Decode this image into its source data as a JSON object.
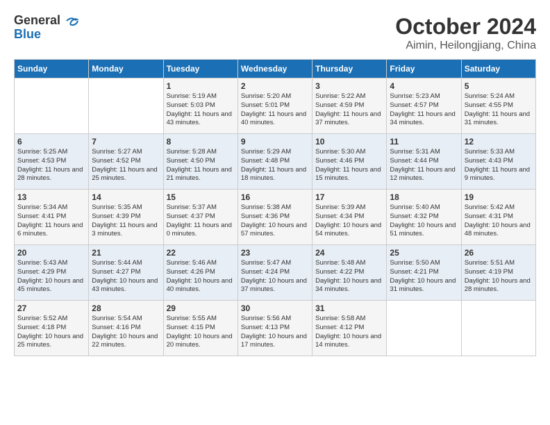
{
  "header": {
    "logo_general": "General",
    "logo_blue": "Blue",
    "month_title": "October 2024",
    "location": "Aimin, Heilongjiang, China"
  },
  "days_of_week": [
    "Sunday",
    "Monday",
    "Tuesday",
    "Wednesday",
    "Thursday",
    "Friday",
    "Saturday"
  ],
  "weeks": [
    [
      {
        "day": "",
        "sunrise": "",
        "sunset": "",
        "daylight": ""
      },
      {
        "day": "",
        "sunrise": "",
        "sunset": "",
        "daylight": ""
      },
      {
        "day": "1",
        "sunrise": "Sunrise: 5:19 AM",
        "sunset": "Sunset: 5:03 PM",
        "daylight": "Daylight: 11 hours and 43 minutes."
      },
      {
        "day": "2",
        "sunrise": "Sunrise: 5:20 AM",
        "sunset": "Sunset: 5:01 PM",
        "daylight": "Daylight: 11 hours and 40 minutes."
      },
      {
        "day": "3",
        "sunrise": "Sunrise: 5:22 AM",
        "sunset": "Sunset: 4:59 PM",
        "daylight": "Daylight: 11 hours and 37 minutes."
      },
      {
        "day": "4",
        "sunrise": "Sunrise: 5:23 AM",
        "sunset": "Sunset: 4:57 PM",
        "daylight": "Daylight: 11 hours and 34 minutes."
      },
      {
        "day": "5",
        "sunrise": "Sunrise: 5:24 AM",
        "sunset": "Sunset: 4:55 PM",
        "daylight": "Daylight: 11 hours and 31 minutes."
      }
    ],
    [
      {
        "day": "6",
        "sunrise": "Sunrise: 5:25 AM",
        "sunset": "Sunset: 4:53 PM",
        "daylight": "Daylight: 11 hours and 28 minutes."
      },
      {
        "day": "7",
        "sunrise": "Sunrise: 5:27 AM",
        "sunset": "Sunset: 4:52 PM",
        "daylight": "Daylight: 11 hours and 25 minutes."
      },
      {
        "day": "8",
        "sunrise": "Sunrise: 5:28 AM",
        "sunset": "Sunset: 4:50 PM",
        "daylight": "Daylight: 11 hours and 21 minutes."
      },
      {
        "day": "9",
        "sunrise": "Sunrise: 5:29 AM",
        "sunset": "Sunset: 4:48 PM",
        "daylight": "Daylight: 11 hours and 18 minutes."
      },
      {
        "day": "10",
        "sunrise": "Sunrise: 5:30 AM",
        "sunset": "Sunset: 4:46 PM",
        "daylight": "Daylight: 11 hours and 15 minutes."
      },
      {
        "day": "11",
        "sunrise": "Sunrise: 5:31 AM",
        "sunset": "Sunset: 4:44 PM",
        "daylight": "Daylight: 11 hours and 12 minutes."
      },
      {
        "day": "12",
        "sunrise": "Sunrise: 5:33 AM",
        "sunset": "Sunset: 4:43 PM",
        "daylight": "Daylight: 11 hours and 9 minutes."
      }
    ],
    [
      {
        "day": "13",
        "sunrise": "Sunrise: 5:34 AM",
        "sunset": "Sunset: 4:41 PM",
        "daylight": "Daylight: 11 hours and 6 minutes."
      },
      {
        "day": "14",
        "sunrise": "Sunrise: 5:35 AM",
        "sunset": "Sunset: 4:39 PM",
        "daylight": "Daylight: 11 hours and 3 minutes."
      },
      {
        "day": "15",
        "sunrise": "Sunrise: 5:37 AM",
        "sunset": "Sunset: 4:37 PM",
        "daylight": "Daylight: 11 hours and 0 minutes."
      },
      {
        "day": "16",
        "sunrise": "Sunrise: 5:38 AM",
        "sunset": "Sunset: 4:36 PM",
        "daylight": "Daylight: 10 hours and 57 minutes."
      },
      {
        "day": "17",
        "sunrise": "Sunrise: 5:39 AM",
        "sunset": "Sunset: 4:34 PM",
        "daylight": "Daylight: 10 hours and 54 minutes."
      },
      {
        "day": "18",
        "sunrise": "Sunrise: 5:40 AM",
        "sunset": "Sunset: 4:32 PM",
        "daylight": "Daylight: 10 hours and 51 minutes."
      },
      {
        "day": "19",
        "sunrise": "Sunrise: 5:42 AM",
        "sunset": "Sunset: 4:31 PM",
        "daylight": "Daylight: 10 hours and 48 minutes."
      }
    ],
    [
      {
        "day": "20",
        "sunrise": "Sunrise: 5:43 AM",
        "sunset": "Sunset: 4:29 PM",
        "daylight": "Daylight: 10 hours and 45 minutes."
      },
      {
        "day": "21",
        "sunrise": "Sunrise: 5:44 AM",
        "sunset": "Sunset: 4:27 PM",
        "daylight": "Daylight: 10 hours and 43 minutes."
      },
      {
        "day": "22",
        "sunrise": "Sunrise: 5:46 AM",
        "sunset": "Sunset: 4:26 PM",
        "daylight": "Daylight: 10 hours and 40 minutes."
      },
      {
        "day": "23",
        "sunrise": "Sunrise: 5:47 AM",
        "sunset": "Sunset: 4:24 PM",
        "daylight": "Daylight: 10 hours and 37 minutes."
      },
      {
        "day": "24",
        "sunrise": "Sunrise: 5:48 AM",
        "sunset": "Sunset: 4:22 PM",
        "daylight": "Daylight: 10 hours and 34 minutes."
      },
      {
        "day": "25",
        "sunrise": "Sunrise: 5:50 AM",
        "sunset": "Sunset: 4:21 PM",
        "daylight": "Daylight: 10 hours and 31 minutes."
      },
      {
        "day": "26",
        "sunrise": "Sunrise: 5:51 AM",
        "sunset": "Sunset: 4:19 PM",
        "daylight": "Daylight: 10 hours and 28 minutes."
      }
    ],
    [
      {
        "day": "27",
        "sunrise": "Sunrise: 5:52 AM",
        "sunset": "Sunset: 4:18 PM",
        "daylight": "Daylight: 10 hours and 25 minutes."
      },
      {
        "day": "28",
        "sunrise": "Sunrise: 5:54 AM",
        "sunset": "Sunset: 4:16 PM",
        "daylight": "Daylight: 10 hours and 22 minutes."
      },
      {
        "day": "29",
        "sunrise": "Sunrise: 5:55 AM",
        "sunset": "Sunset: 4:15 PM",
        "daylight": "Daylight: 10 hours and 20 minutes."
      },
      {
        "day": "30",
        "sunrise": "Sunrise: 5:56 AM",
        "sunset": "Sunset: 4:13 PM",
        "daylight": "Daylight: 10 hours and 17 minutes."
      },
      {
        "day": "31",
        "sunrise": "Sunrise: 5:58 AM",
        "sunset": "Sunset: 4:12 PM",
        "daylight": "Daylight: 10 hours and 14 minutes."
      },
      {
        "day": "",
        "sunrise": "",
        "sunset": "",
        "daylight": ""
      },
      {
        "day": "",
        "sunrise": "",
        "sunset": "",
        "daylight": ""
      }
    ]
  ]
}
